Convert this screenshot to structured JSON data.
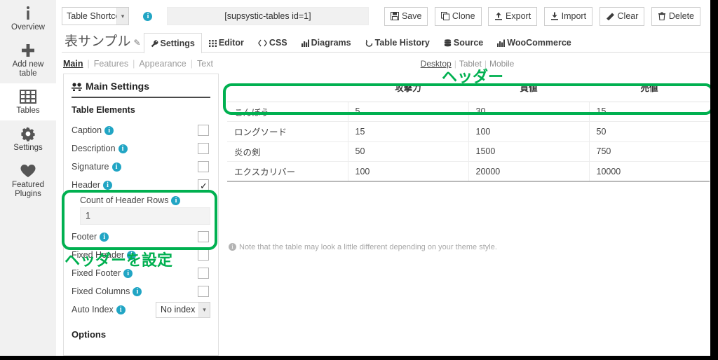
{
  "colors": {
    "annotation_green": "#00b050",
    "info_blue": "#21a5c4",
    "rail_bg": "#f1f1f1"
  },
  "sidebar": {
    "items": [
      {
        "icon": "info-icon",
        "label": "Overview",
        "active": false
      },
      {
        "icon": "plus-icon",
        "label": "Add new\ntable",
        "active": false
      },
      {
        "icon": "table-grid-icon",
        "label": "Tables",
        "active": true
      },
      {
        "icon": "gear-icon",
        "label": "Settings",
        "active": false
      },
      {
        "icon": "heart-icon",
        "label": "Featured\nPlugins",
        "active": false
      }
    ]
  },
  "topbar": {
    "shortcode_select_value": "Table Shortcode",
    "shortcode_info_icon": "info-circle-icon",
    "shortcode_value": "[supsystic-tables id=1]",
    "buttons": [
      {
        "icon": "save-floppy-icon",
        "label": "Save"
      },
      {
        "icon": "clone-copy-icon",
        "label": "Clone"
      },
      {
        "icon": "export-upload-icon",
        "label": "Export"
      },
      {
        "icon": "import-download-icon",
        "label": "Import"
      },
      {
        "icon": "eraser-icon",
        "label": "Clear"
      },
      {
        "icon": "trash-icon",
        "label": "Delete"
      }
    ]
  },
  "tabs": {
    "table_title": "表サンプル",
    "edit_pencil_icon": "pencil-icon",
    "items": [
      {
        "icon": "wrench-icon",
        "label": "Settings",
        "active": true
      },
      {
        "icon": "grid-icon",
        "label": "Editor",
        "active": false
      },
      {
        "icon": "code-icon",
        "label": "CSS",
        "active": false
      },
      {
        "icon": "bar-chart-icon",
        "label": "Diagrams",
        "active": false
      },
      {
        "icon": "undo-clock-icon",
        "label": "Table History",
        "active": false
      },
      {
        "icon": "database-stack-icon",
        "label": "Source",
        "active": false
      },
      {
        "icon": "bar-chart-icon",
        "label": "WooCommerce",
        "active": false
      }
    ]
  },
  "subtabs": [
    {
      "label": "Main",
      "active": true
    },
    {
      "label": "Features",
      "active": false
    },
    {
      "label": "Appearance",
      "active": false
    },
    {
      "label": "Text",
      "active": false
    }
  ],
  "settings": {
    "card_title": "Main Settings",
    "card_title_icon": "sliders-icon",
    "section_title": "Table Elements",
    "rows": [
      {
        "label": "Caption",
        "checked": false
      },
      {
        "label": "Description",
        "checked": false
      },
      {
        "label": "Signature",
        "checked": false
      },
      {
        "label": "Header",
        "checked": true
      }
    ],
    "header_sub_label": "Count of Header Rows",
    "header_rows_value": "1",
    "footer_label": "Footer",
    "more_rows": [
      {
        "label": "Fixed Header",
        "checked": false
      },
      {
        "label": "Fixed Footer",
        "checked": false
      },
      {
        "label": "Fixed Columns",
        "checked": false
      }
    ],
    "auto_index_label": "Auto Index",
    "auto_index_value": "No index",
    "options_title": "Options"
  },
  "preview": {
    "devices": [
      {
        "label": "Desktop",
        "active": true
      },
      {
        "label": "Tablet",
        "active": false
      },
      {
        "label": "Mobile",
        "active": false
      }
    ],
    "headers": [
      "",
      "攻撃力",
      "買値",
      "売値"
    ],
    "rows": [
      [
        "こんぼう",
        "5",
        "30",
        "15"
      ],
      [
        "ロングソード",
        "15",
        "100",
        "50"
      ],
      [
        "炎の剣",
        "50",
        "1500",
        "750"
      ],
      [
        "エクスカリバー",
        "100",
        "20000",
        "10000"
      ]
    ],
    "note": "Note that the table may look a little different depending on your theme style.",
    "note_icon": "info-circle-icon"
  },
  "annotations": {
    "header_label": "ヘッダー",
    "settings_label": "ヘッダーを設定"
  }
}
